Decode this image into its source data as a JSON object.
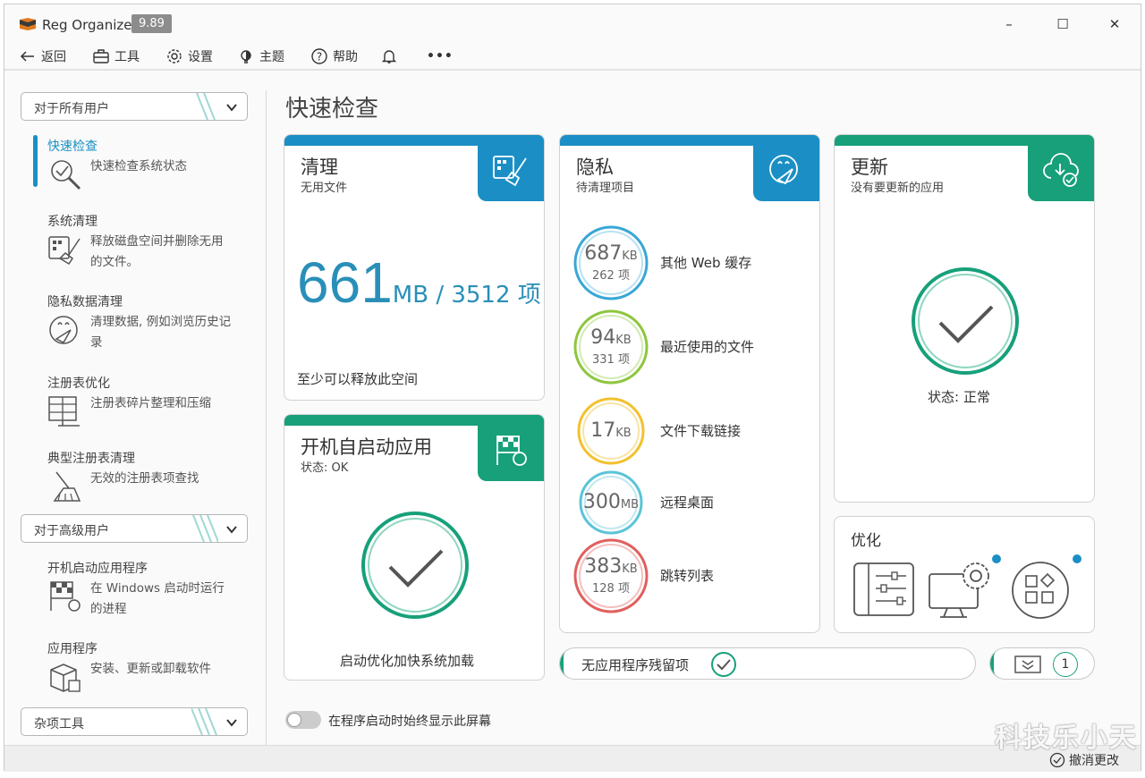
{
  "app": {
    "title": "Reg Organizer",
    "version": "9.89"
  },
  "window_controls": {
    "minimize": "–",
    "maximize": "☐",
    "close": "✕"
  },
  "toolbar": {
    "back": "返回",
    "tools": "工具",
    "settings": "设置",
    "theme": "主题",
    "help": "帮助",
    "more": "•••"
  },
  "sidebar": {
    "group_all": "对于所有用户",
    "group_advanced": "对于高级用户",
    "group_misc": "杂项工具",
    "items": [
      {
        "title": "快速检查",
        "desc": "快速检查系统状态"
      },
      {
        "title": "系统清理",
        "desc": "释放磁盘空间并删除无用的文件。"
      },
      {
        "title": "隐私数据清理",
        "desc": "清理数据, 例如浏览历史记录"
      },
      {
        "title": "注册表优化",
        "desc": "注册表碎片整理和压缩"
      },
      {
        "title": "典型注册表清理",
        "desc": "无效的注册表项查找"
      }
    ],
    "advanced_items": [
      {
        "title": "开机启动应用程序",
        "desc": "在 Windows 启动时运行的进程"
      },
      {
        "title": "应用程序",
        "desc": "安装、更新或卸载软件"
      }
    ]
  },
  "main": {
    "title": "快速检查",
    "clean": {
      "title": "清理",
      "sub": "无用文件",
      "number": "661",
      "unit": "MB / 3512 项",
      "footer": "至少可以释放此空间"
    },
    "startup": {
      "title": "开机自启动应用",
      "sub": "状态: OK",
      "footer": "启动优化加快系统加载"
    },
    "privacy": {
      "title": "隐私",
      "sub": "待清理项目",
      "rows": [
        {
          "value": "687",
          "unit": "KB",
          "count": "262 项",
          "label": "其他 Web 缓存",
          "color": "#39a7d6"
        },
        {
          "value": "94",
          "unit": "KB",
          "count": "331 项",
          "label": "最近使用的文件",
          "color": "#8dc63f"
        },
        {
          "value": "17",
          "unit": "KB",
          "count": "",
          "label": "文件下载链接",
          "color": "#f2c12e"
        },
        {
          "value": "300",
          "unit": "MB",
          "count": "",
          "label": "远程桌面",
          "color": "#5bc4d8"
        },
        {
          "value": "383",
          "unit": "KB",
          "count": "128 项",
          "label": "跳转列表",
          "color": "#e0605e"
        }
      ]
    },
    "update": {
      "title": "更新",
      "sub": "没有要更新的应用",
      "status": "状态: 正常"
    },
    "optimize": {
      "title": "优化"
    },
    "leftovers": {
      "label": "无应用程序残留项"
    },
    "badge": {
      "count": "1"
    },
    "toggle_label": "在程序启动时始终显示此屏幕"
  },
  "statusbar": {
    "undo": "撤消更改"
  },
  "watermark": "科技乐小天",
  "colors": {
    "blue": "#1b8fc5",
    "green": "#17a07a",
    "num_blue": "#2a8fb8"
  }
}
